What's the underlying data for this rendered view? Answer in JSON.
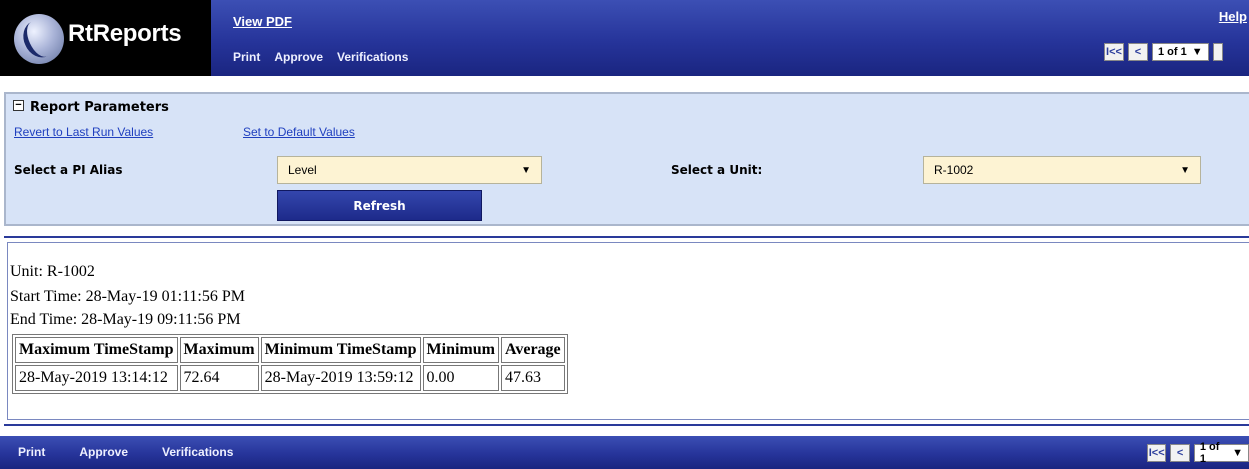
{
  "header": {
    "logo_text": "RtReports",
    "view_pdf": "View PDF",
    "help": "Help",
    "toolbar": [
      "Print",
      "Approve",
      "Verifications"
    ],
    "pager": {
      "first": "I<<",
      "prev": "<",
      "page": "1 of 1",
      "arrow": "▼"
    }
  },
  "params": {
    "title": "Report Parameters",
    "toggle": "−",
    "revert_link": "Revert to Last Run Values",
    "default_link": "Set to Default Values",
    "alias_label": "Select a PI Alias",
    "alias_value": "Level",
    "unit_label": "Select a Unit:",
    "unit_value": "R-1002",
    "refresh": "Refresh",
    "arrow": "▼"
  },
  "report": {
    "unit": "Unit: R-1002",
    "start": "Start Time: 28-May-19 01:11:56 PM",
    "end": "End Time: 28-May-19 09:11:56 PM",
    "columns": [
      "Maximum TimeStamp",
      "Maximum",
      "Minimum TimeStamp",
      "Minimum",
      "Average"
    ],
    "row": [
      "28-May-2019 13:14:12",
      "72.64",
      "28-May-2019 13:59:12",
      "0.00",
      "47.63"
    ]
  },
  "footer": {
    "toolbar": [
      "Print",
      "Approve",
      "Verifications"
    ],
    "pager": {
      "first": "I<<",
      "prev": "<",
      "page": "1 of 1",
      "arrow": "▼"
    }
  },
  "colors": {
    "header_blue": "#26349a",
    "panel_bg": "#d7e3f7",
    "select_bg": "#fdf3d3",
    "link_blue": "#1f3fbf"
  }
}
